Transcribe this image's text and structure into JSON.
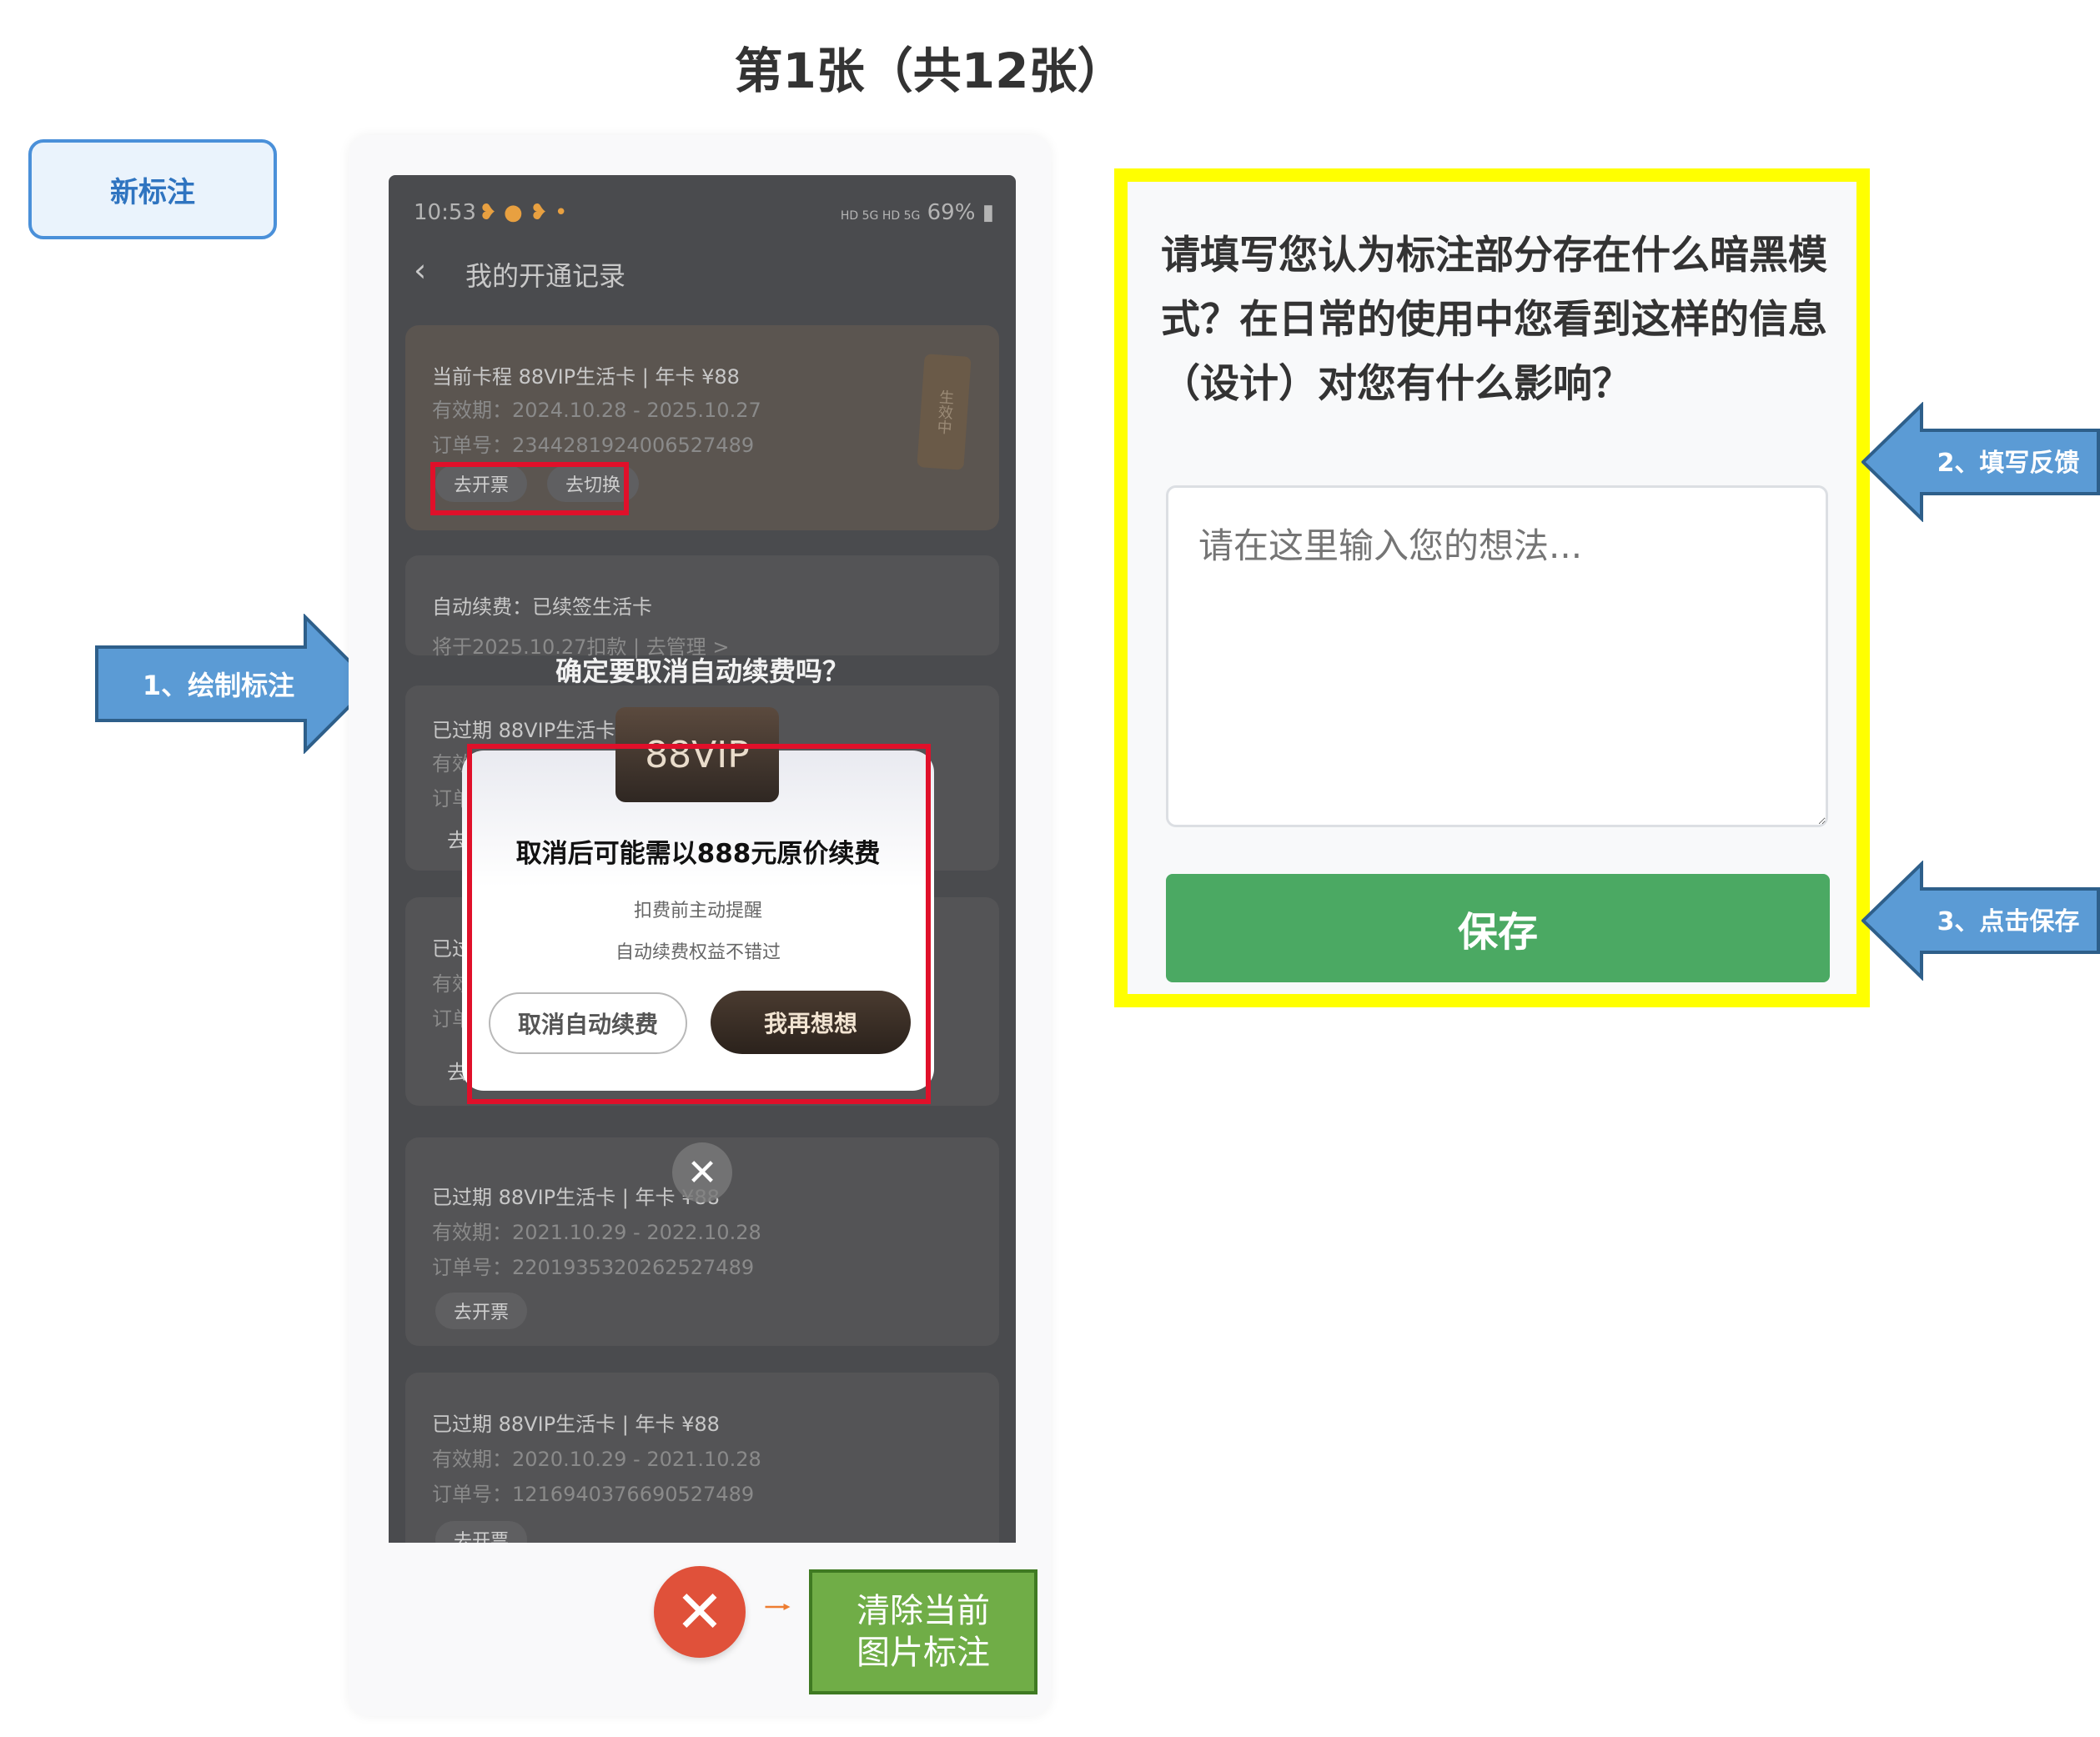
{
  "header": {
    "title": "第1张（共12张）"
  },
  "toolbar": {
    "new_annotation_label": "新标注"
  },
  "phone": {
    "status": {
      "time": "10:53",
      "battery": "69%",
      "signal": "HD 5G HD 5G"
    },
    "nav": {
      "title": "我的开通记录"
    },
    "current_card": {
      "title": "当前卡程 88VIP生活卡 | 年卡 ¥88",
      "validity": "有效期：2024.10.28 - 2025.10.27",
      "order": "订单号：2344281924006527489",
      "btn_invoice": "去开票",
      "btn_switch": "去切换",
      "stamp": "生效中"
    },
    "auto_renew": {
      "title": "自动续费：已续签生活卡",
      "note": "将于2025.10.27扣款 | 去管理 >"
    },
    "expired_partial": [
      {
        "title": "已过期 88VIP生活卡",
        "validity": "有效",
        "order": "订单",
        "btn": "去"
      },
      {
        "title": "已过",
        "validity": "有效",
        "order": "订单",
        "btn": "去"
      }
    ],
    "expired_cards": [
      {
        "title": "已过期 88VIP生活卡 | 年卡 ¥88",
        "validity": "有效期：2021.10.29 - 2022.10.28",
        "order": "订单号：2201935320262527489",
        "btn": "去开票"
      },
      {
        "title": "已过期 88VIP生活卡 | 年卡 ¥88",
        "validity": "有效期：2020.10.29 - 2021.10.28",
        "order": "订单号：1216940376690527489",
        "btn": "去开票"
      }
    ],
    "dialog": {
      "top_title": "确定要取消自动续费吗？",
      "vip_badge": "88VIP",
      "title": "取消后可能需以888元原价续费",
      "sub1": "扣费前主动提醒",
      "sub2": "自动续费权益不错过",
      "btn_cancel": "取消自动续费",
      "btn_keep": "我再想想",
      "close": "✕"
    }
  },
  "clear": {
    "icon": "✕",
    "label_line1": "清除当前",
    "label_line2": "图片标注"
  },
  "feedback": {
    "question": "请填写您认为标注部分存在什么暗黑模式？在日常的使用中您看到这样的信息（设计）对您有什么影响？",
    "placeholder": "请在这里输入您的想法...",
    "save_label": "保存"
  },
  "callouts": {
    "step1": "1、绘制标注",
    "step2": "2、填写反馈",
    "step3": "3、点击保存"
  },
  "colors": {
    "annotation_red": "#e0102a",
    "highlight_yellow": "#ffff00",
    "save_green": "#4ba963",
    "callout_blue": "#5b9bd5",
    "clear_red": "#e0513a",
    "clear_label_green": "#70ad47"
  }
}
